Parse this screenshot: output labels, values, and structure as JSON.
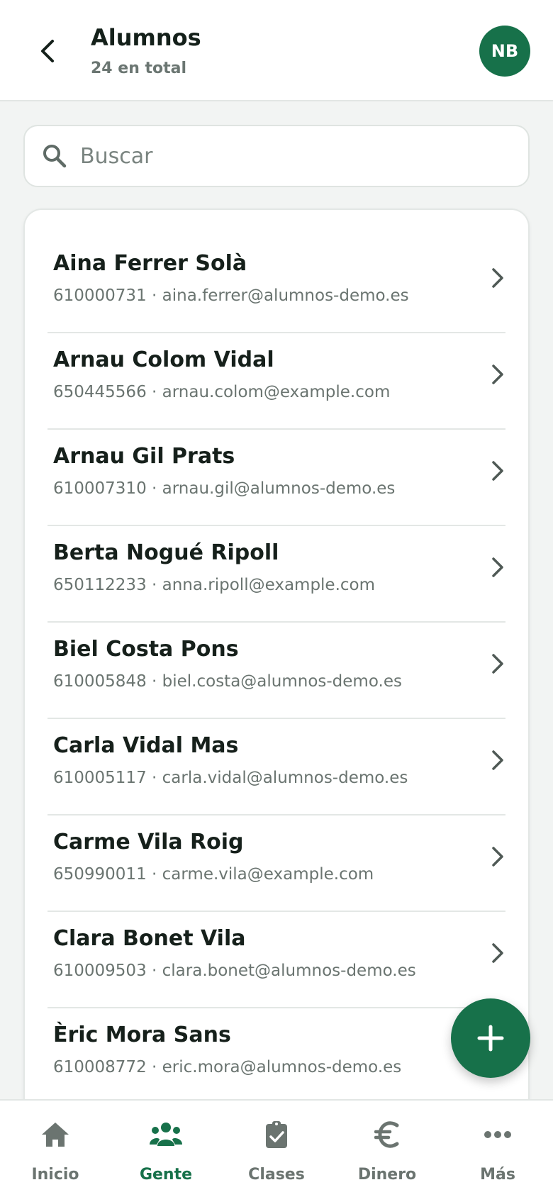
{
  "header": {
    "title": "Alumnos",
    "subtitle": "24 en total",
    "avatar_initials": "NB"
  },
  "search": {
    "placeholder": "Buscar",
    "value": ""
  },
  "students": [
    {
      "name": "Aina Ferrer Solà",
      "meta": "610000731 · aina.ferrer@alumnos-demo.es"
    },
    {
      "name": "Arnau Colom Vidal",
      "meta": "650445566 · arnau.colom@example.com"
    },
    {
      "name": "Arnau Gil Prats",
      "meta": "610007310 · arnau.gil@alumnos-demo.es"
    },
    {
      "name": "Berta Nogué Ripoll",
      "meta": "650112233 · anna.ripoll@example.com"
    },
    {
      "name": "Biel Costa Pons",
      "meta": "610005848 · biel.costa@alumnos-demo.es"
    },
    {
      "name": "Carla Vidal Mas",
      "meta": "610005117 · carla.vidal@alumnos-demo.es"
    },
    {
      "name": "Carme Vila Roig",
      "meta": "650990011 · carme.vila@example.com"
    },
    {
      "name": "Clara Bonet Vila",
      "meta": "610009503 · clara.bonet@alumnos-demo.es"
    },
    {
      "name": "Èric Mora Sans",
      "meta": "610008772 · eric.mora@alumnos-demo.es"
    }
  ],
  "nav": [
    {
      "label": "Inicio",
      "icon": "home-icon",
      "active": false
    },
    {
      "label": "Gente",
      "icon": "people-icon",
      "active": true
    },
    {
      "label": "Clases",
      "icon": "clipboard-check-icon",
      "active": false
    },
    {
      "label": "Dinero",
      "icon": "euro-icon",
      "active": false
    },
    {
      "label": "Más",
      "icon": "more-dots-icon",
      "active": false
    }
  ],
  "colors": {
    "accent": "#17714a",
    "nav_inactive": "#6b7470",
    "background": "#f2f4f3"
  }
}
